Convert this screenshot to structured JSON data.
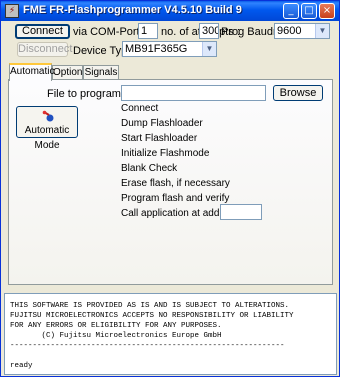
{
  "window": {
    "title": "FME FR-Flashprogrammer V4.5.10 Build 9",
    "min_label": "_",
    "max_label": "□",
    "close_label": "×"
  },
  "connection": {
    "connect_label": "Connect",
    "disconnect_label": "Disconnect",
    "via_label": "via COM-Port",
    "com_port_value": "1",
    "attempts_label": "no. of attempts :",
    "attempts_value": "300",
    "baudrate_label": "Prog Baudrate :",
    "baudrate_value": "9600",
    "device_type_label": "Device Type :",
    "device_type_value": "MB91F365G"
  },
  "tabs": [
    {
      "label": "Automatic"
    },
    {
      "label": "Options"
    },
    {
      "label": "Signals"
    }
  ],
  "automatic": {
    "file_label": "File to program :",
    "file_value": "",
    "browse_label": "Browse",
    "auto_mode_label": "Automatic Mode",
    "steps": [
      "Connect",
      "Dump Flashloader",
      "Start Flashloader",
      "Initialize Flashmode",
      "Blank Check",
      "Erase flash, if necessary",
      "Program flash and verify",
      "Call application at address"
    ],
    "address_value": ""
  },
  "log": {
    "lines": [
      "THIS SOFTWARE IS PROVIDED AS IS AND IS SUBJECT TO ALTERATIONS.",
      "FUJITSU MICROELECTRONICS ACCEPTS NO RESPONSIBILITY OR LIABILITY",
      "FOR ANY ERRORS OR ELIGIBILITY FOR ANY PURPOSES.",
      "       (C) Fujitsu Microelectronics Europe GmbH",
      "-------------------------------------------------------------",
      "",
      "ready"
    ]
  },
  "colors": {
    "titlebar": "#0058ee",
    "window_bg": "#ece9d8",
    "tab_highlight": "#ffc83c"
  }
}
